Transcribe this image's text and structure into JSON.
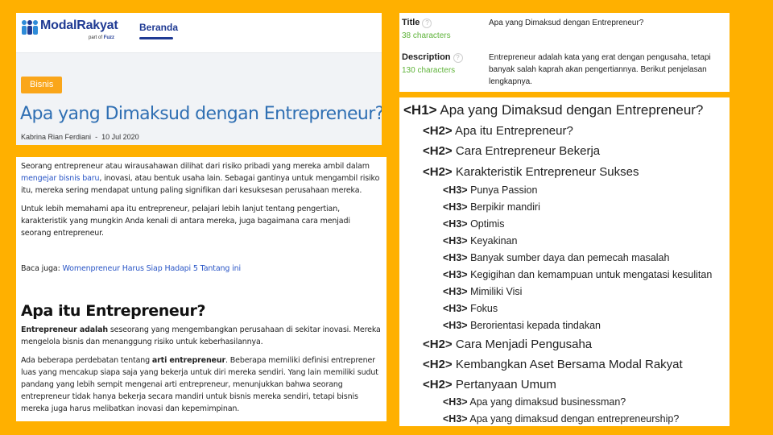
{
  "site": {
    "brand": "ModalRakyat",
    "partof_prefix": "part of",
    "partof_brand": "Fuzz",
    "nav_tab": "Beranda"
  },
  "article": {
    "category": "Bisnis",
    "title": "Apa yang Dimaksud dengan Entrepreneur?",
    "author": "Kabrina Rian Ferdiani",
    "separator": "-",
    "date": "10 Jul 2020",
    "p1_before": "Seorang entrepreneur atau wirausahawan dilihat dari risiko pribadi yang mereka ambil dalam ",
    "p1_link": "mengejar bisnis baru",
    "p1_after": ", inovasi, atau bentuk usaha lain. Sebagai gantinya untuk mengambil risiko itu, mereka sering mendapat untung paling signifikan dari kesuksesan perusahaan mereka.",
    "p2": "Untuk lebih memahami apa itu entrepreneur, pelajari lebih lanjut tentang pengertian, karakteristik yang mungkin Anda kenali di antara mereka, juga bagaimana cara menjadi seorang entrepreneur.",
    "baca_label": "Baca juga:",
    "baca_link": "Womenpreneur Harus Siap Hadapi 5 Tantang ini",
    "section_title": "Apa itu Entrepreneur?",
    "p3_bold": "Entrepreneur adalah",
    "p3_rest": " seseorang yang mengembangkan perusahaan di sekitar inovasi. Mereka mengelola bisnis dan menanggung risiko untuk keberhasilannya.",
    "p4_before": "Ada beberapa perdebatan tentang ",
    "p4_bold": "arti entrepreneur",
    "p4_after": ". Beberapa memiliki definisi entreprener luas yang mencakup siapa saja yang bekerja untuk diri mereka sendiri. Yang lain memiliki sudut pandang yang lebih sempit mengenai arti entrepreneur, menunjukkan bahwa seorang entrepreneur tidak hanya bekerja secara mandiri untuk bisnis mereka sendiri, tetapi bisnis mereka juga harus melibatkan inovasi dan kepemimpinan."
  },
  "seo": {
    "title_label": "Title",
    "title_count": "38 characters",
    "title_value": "Apa yang Dimaksud dengan Entrepreneur?",
    "desc_label": "Description",
    "desc_count": "130 characters",
    "desc_value": "Entrepreneur adalah kata yang erat dengan pengusaha, tetapi banyak salah kaprah akan pengertiannya. Berikut penjelasan lengkapnya.",
    "help_glyph": "?"
  },
  "outline": [
    {
      "tag": "<H1>",
      "text": "Apa yang Dimaksud dengan Entrepreneur?"
    },
    {
      "tag": "<H2>",
      "text": "Apa itu Entrepreneur?"
    },
    {
      "tag": "<H2>",
      "text": "Cara Entrepreneur Bekerja"
    },
    {
      "tag": "<H2>",
      "text": "Karakteristik Entrepreneur Sukses"
    },
    {
      "tag": "<H3>",
      "text": "Punya Passion"
    },
    {
      "tag": "<H3>",
      "text": "Berpikir mandiri"
    },
    {
      "tag": "<H3>",
      "text": "Optimis"
    },
    {
      "tag": "<H3>",
      "text": "Keyakinan"
    },
    {
      "tag": "<H3>",
      "text": "Banyak sumber daya dan pemecah masalah"
    },
    {
      "tag": "<H3>",
      "text": "Kegigihan dan kemampuan untuk mengatasi kesulitan"
    },
    {
      "tag": "<H3>",
      "text": "Mimiliki Visi"
    },
    {
      "tag": "<H3>",
      "text": "Fokus"
    },
    {
      "tag": "<H3>",
      "text": "Berorientasi kepada tindakan"
    },
    {
      "tag": "<H2>",
      "text": "Cara Menjadi Pengusaha"
    },
    {
      "tag": "<H2>",
      "text": "Kembangkan Aset Bersama Modal Rakyat"
    },
    {
      "tag": "<H2>",
      "text": "Pertanyaan Umum"
    },
    {
      "tag": "<H3>",
      "text": "Apa yang dimaksud businessman?"
    },
    {
      "tag": "<H3>",
      "text": "Apa yang dimaksud dengan entrepreneurship?"
    }
  ],
  "colors": {
    "background": "#FFB000",
    "brand_blue": "#1F3A93",
    "title_blue": "#2F6FB3",
    "badge_orange": "#FAA61A",
    "count_green": "#5FB33A"
  }
}
